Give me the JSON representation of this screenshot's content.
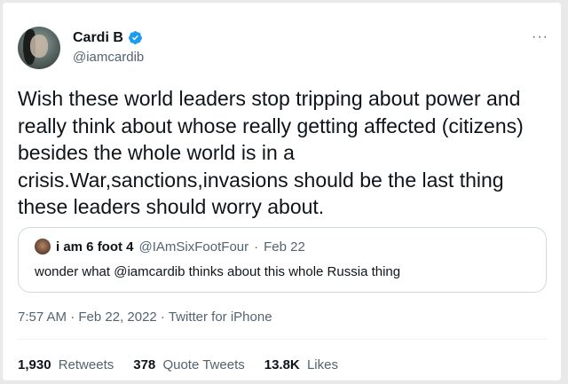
{
  "author": {
    "name": "Cardi B",
    "handle": "@iamcardib"
  },
  "more_label": "···",
  "tweet_text": "Wish these world leaders stop tripping about power and really think about whose really getting affected (citizens) besides the whole world is in a crisis.War,sanctions,invasions should be the last thing these leaders should worry about.",
  "quoted_tweet": {
    "name": "i am 6 foot 4",
    "handle": "@IAmSixFootFour",
    "separator": "·",
    "date": "Feb 22",
    "text": "wonder what @iamcardib thinks about this whole Russia thing"
  },
  "meta": "7:57 AM · Feb 22, 2022 · Twitter for iPhone",
  "stats": {
    "retweets_count": "1,930",
    "retweets_label": "Retweets",
    "quotes_count": "378",
    "quotes_label": "Quote Tweets",
    "likes_count": "13.8K",
    "likes_label": "Likes"
  },
  "colors": {
    "verified": "#1d9bf0",
    "secondary_text": "#536471",
    "border": "#cfd9de"
  }
}
